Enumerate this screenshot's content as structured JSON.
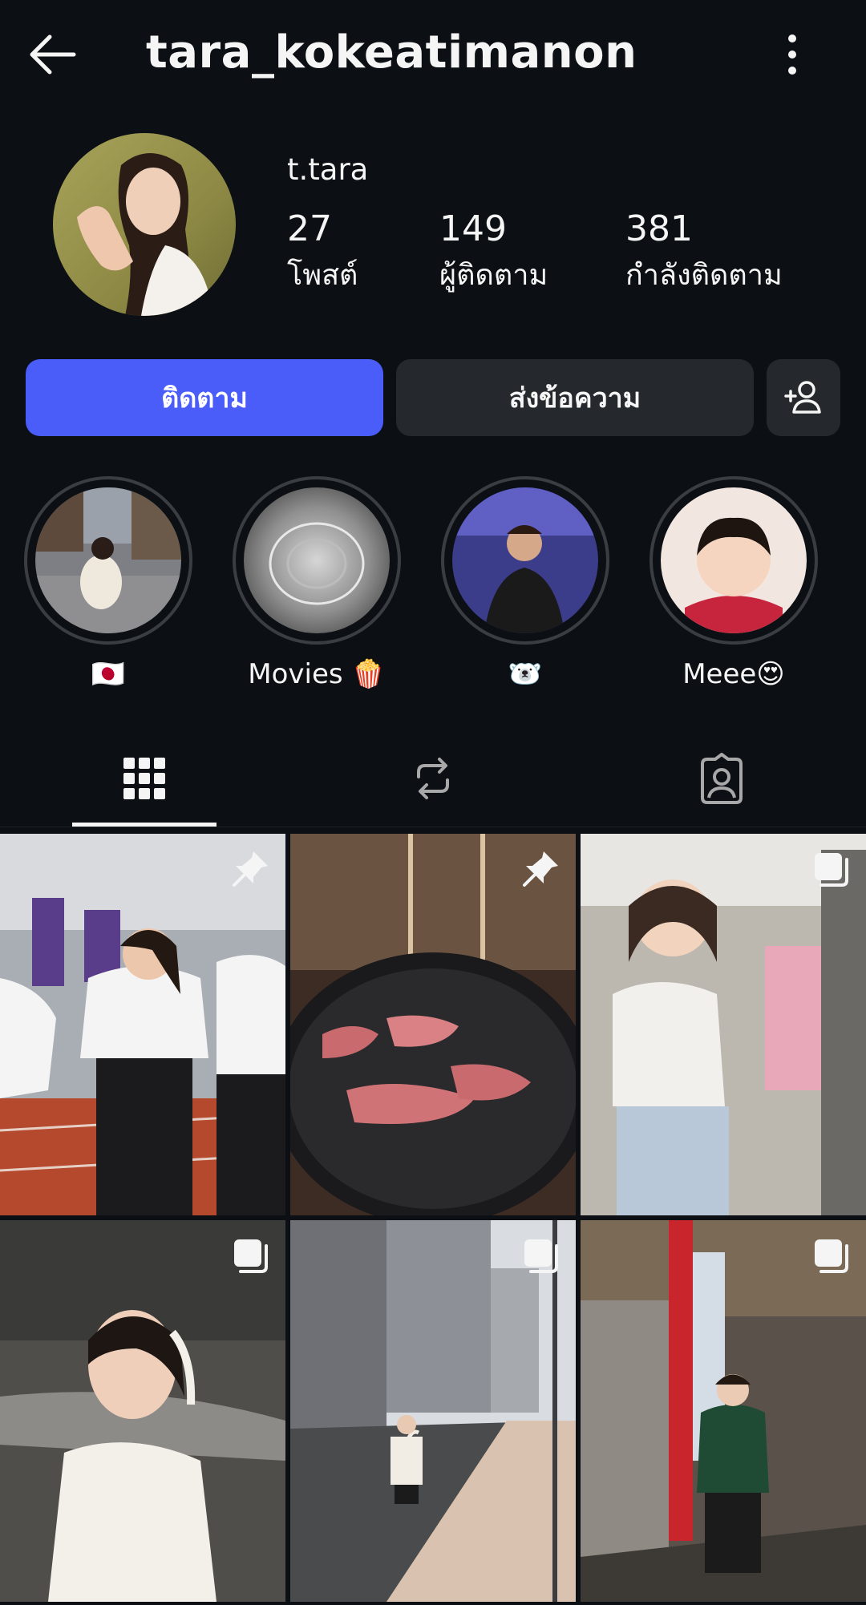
{
  "header": {
    "username": "tara_kokeatimanon"
  },
  "profile": {
    "display_name": "t.tara",
    "stats": [
      {
        "value": "27",
        "label": "โพสต์"
      },
      {
        "value": "149",
        "label": "ผู้ติดตาม"
      },
      {
        "value": "381",
        "label": "กำลังติดตาม"
      }
    ]
  },
  "actions": {
    "follow_label": "ติดตาม",
    "message_label": "ส่งข้อความ"
  },
  "highlights": [
    {
      "label": "🇯🇵"
    },
    {
      "label": "Movies 🍿"
    },
    {
      "label": "🐻‍❄️"
    },
    {
      "label": "Meee😍"
    }
  ],
  "tabs": [
    {
      "icon": "grid-icon",
      "active": true
    },
    {
      "icon": "reels-repost-icon",
      "active": false
    },
    {
      "icon": "tagged-icon",
      "active": false
    }
  ],
  "posts": [
    {
      "badge": "pin-icon"
    },
    {
      "badge": "pin-icon"
    },
    {
      "badge": "carousel-icon"
    },
    {
      "badge": "carousel-icon"
    },
    {
      "badge": "carousel-icon"
    },
    {
      "badge": "carousel-icon"
    }
  ],
  "colors": {
    "background": "#0c1014",
    "follow_button": "#4a5df9",
    "secondary_button": "#25292e"
  }
}
